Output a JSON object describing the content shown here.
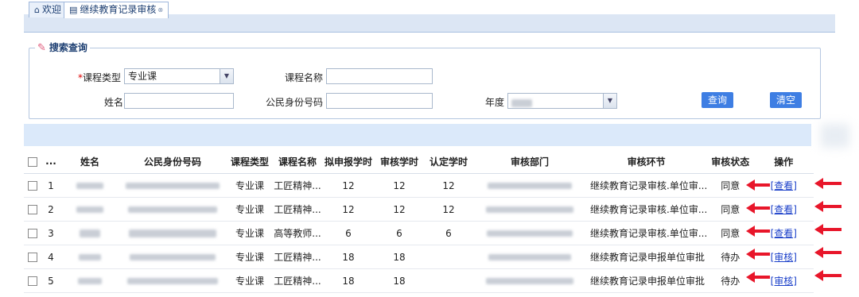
{
  "tabs": [
    {
      "icon": "home-icon",
      "label": "欢迎"
    },
    {
      "icon": "document-icon",
      "label": "继续教育记录审核",
      "close": "⊗"
    }
  ],
  "search": {
    "legend": "搜索查询",
    "course_type_required": "*",
    "course_type_label": "课程类型",
    "course_type_value": "专业课",
    "course_name_label": "课程名称",
    "course_name_value": "",
    "name_label": "姓名",
    "name_value": "",
    "id_label": "公民身份号码",
    "id_value": "",
    "year_label": "年度",
    "query_button": "查询",
    "clear_button": "清空"
  },
  "table": {
    "headers": [
      "",
      "...",
      "姓名",
      "公民身份号码",
      "课程类型",
      "课程名称",
      "拟申报学时",
      "审核学时",
      "认定学时",
      "审核部门",
      "审核环节",
      "审核状态",
      "操作"
    ],
    "rows": [
      {
        "no": "1",
        "course_type": "专业课",
        "course_name": "工匠精神...",
        "declared": "12",
        "audited": "12",
        "recognized": "12",
        "stage": "继续教育记录审核.单位审...",
        "status": "同意",
        "action": "[查看]"
      },
      {
        "no": "2",
        "course_type": "专业课",
        "course_name": "工匠精神...",
        "declared": "12",
        "audited": "12",
        "recognized": "12",
        "stage": "继续教育记录审核.单位审...",
        "status": "同意",
        "action": "[查看]"
      },
      {
        "no": "3",
        "course_type": "专业课",
        "course_name": "高等教师...",
        "declared": "6",
        "audited": "6",
        "recognized": "6",
        "stage": "继续教育记录审核.单位审...",
        "status": "同意",
        "action": "[查看]"
      },
      {
        "no": "4",
        "course_type": "专业课",
        "course_name": "工匠精神...",
        "declared": "18",
        "audited": "18",
        "recognized": "",
        "stage": "继续教育记录申报单位审批",
        "status": "待办",
        "action": "[审核]"
      },
      {
        "no": "5",
        "course_type": "专业课",
        "course_name": "工匠精神...",
        "declared": "18",
        "audited": "18",
        "recognized": "",
        "stage": "继续教育记录申报单位审批",
        "status": "待办",
        "action": "[审核]"
      }
    ]
  },
  "colors": {
    "accent": "#3e7ee3",
    "toolbar": "#dbe9fa",
    "link": "#1a3fc9",
    "annotation_arrow": "#e8162a"
  }
}
